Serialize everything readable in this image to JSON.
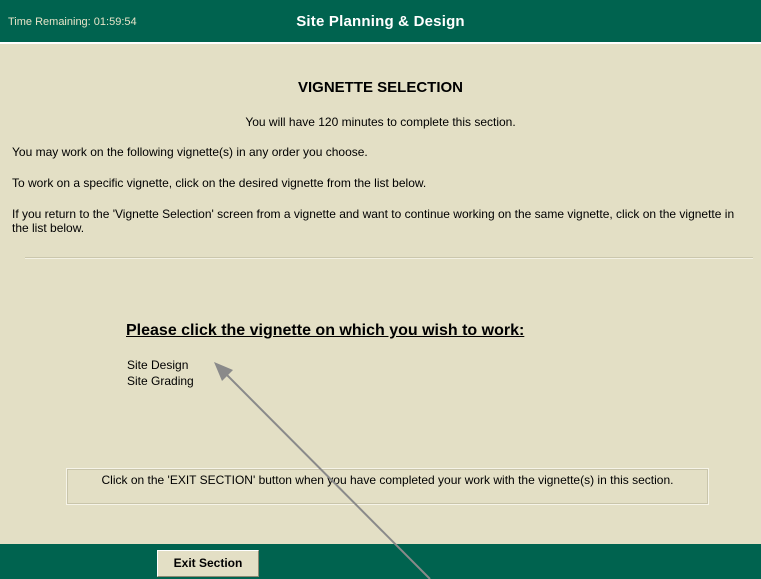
{
  "header": {
    "timer": "Time Remaining: 01:59:54",
    "title": "Site Planning & Design"
  },
  "main": {
    "section_title": "VIGNETTE SELECTION",
    "time_note": "You will have 120 minutes to complete this section.",
    "instructions": [
      "You may work on the following vignette(s) in any order you choose.",
      "To work on a specific vignette, click on the desired vignette from the list below.",
      "If you return to the 'Vignette Selection' screen from a vignette and want to continue working on the same vignette, click on the vignette in the list below."
    ],
    "prompt": "Please click the vignette on which you wish to work:",
    "vignettes": [
      "Site Design",
      "Site Grading"
    ],
    "exit_note": "Click on the 'EXIT SECTION' button when you have completed your work with the vignette(s) in this section."
  },
  "footer": {
    "exit_label": "Exit Section"
  },
  "colors": {
    "bar": "#00634f",
    "panel": "#e3dfc5",
    "annotation_arrow": "#8a8a8a"
  }
}
